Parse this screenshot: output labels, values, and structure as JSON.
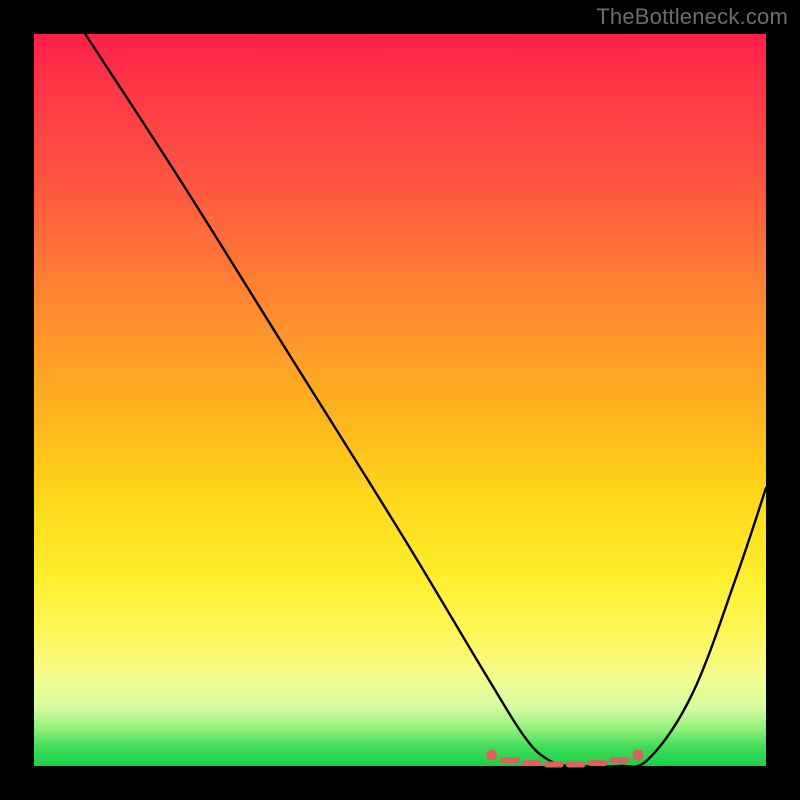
{
  "watermark": "TheBottleneck.com",
  "colors": {
    "frame": "#000000",
    "watermark": "#6d6d6d",
    "curve": "#000000",
    "marker": "#d9645e",
    "gradient_top": "#ff1f47",
    "gradient_bottom": "#19cf47"
  },
  "chart_data": {
    "type": "line",
    "title": "",
    "xlabel": "",
    "ylabel": "",
    "xlim": [
      0,
      100
    ],
    "ylim": [
      0,
      100
    ],
    "grid": false,
    "legend": false,
    "series": [
      {
        "name": "bottleneck-curve",
        "x": [
          7,
          20,
          35,
          50,
          62,
          67,
          70,
          73,
          77,
          80,
          84,
          90,
          96,
          100
        ],
        "y": [
          100,
          80,
          56,
          32,
          12,
          4,
          1,
          0,
          0,
          0,
          1,
          10,
          26,
          38
        ]
      },
      {
        "name": "optimal-range-markers",
        "x": [
          62.5,
          65,
          68,
          71,
          74,
          77,
          80,
          82.5
        ],
        "y": [
          1.5,
          0.8,
          0.4,
          0.2,
          0.2,
          0.4,
          0.8,
          1.5
        ]
      }
    ],
    "annotations": []
  }
}
